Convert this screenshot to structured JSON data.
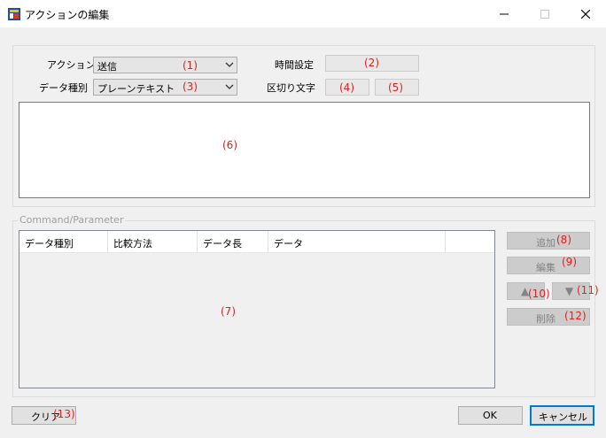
{
  "window": {
    "title": "アクションの編集",
    "icon": "app-icon",
    "controls": [
      "minimize-icon",
      "maximize-icon",
      "close-icon"
    ]
  },
  "top_group": {
    "action_label": "アクション",
    "action_value": "送信",
    "action_marker": "(1)",
    "time_setting_label": "時間設定",
    "time_setting_marker": "(2)",
    "data_type_label": "データ種別",
    "data_type_value": "プレーンテキスト",
    "data_type_marker": "(3)",
    "delimiter_label": "区切り文字",
    "delimiter_marker_1": "(4)",
    "delimiter_marker_2": "(5)",
    "text_marker": "(6)"
  },
  "command_group": {
    "caption": "Command/Parameter",
    "columns": [
      "データ種別",
      "比較方法",
      "データ長",
      "データ"
    ],
    "list_marker": "(7)",
    "add_label": "追加",
    "add_marker": "(8)",
    "edit_label": "編集",
    "edit_marker": "(9)",
    "up_icon": "▲",
    "up_marker": "(10)",
    "down_icon": "▼",
    "down_marker": "(11)",
    "delete_label": "削除",
    "delete_marker": "(12)"
  },
  "footer": {
    "clear_label": "クリア",
    "clear_marker": "(13)",
    "ok_label": "OK",
    "cancel_label": "キャンセル"
  },
  "colors": {
    "marker": "#e02020",
    "accent": "#0078d7"
  }
}
